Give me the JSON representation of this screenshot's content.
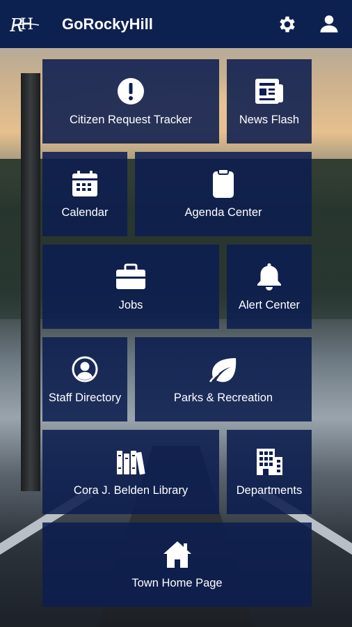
{
  "app": {
    "title": "GoRockyHill",
    "logo_text": "RH"
  },
  "tiles": [
    {
      "label": "Citizen Request Tracker",
      "icon": "exclamation-circle-icon"
    },
    {
      "label": "News Flash",
      "icon": "newspaper-icon"
    },
    {
      "label": "Calendar",
      "icon": "calendar-icon"
    },
    {
      "label": "Agenda Center",
      "icon": "clipboard-icon"
    },
    {
      "label": "Jobs",
      "icon": "briefcase-icon"
    },
    {
      "label": "Alert Center",
      "icon": "bell-icon"
    },
    {
      "label": "Staff Directory",
      "icon": "user-circle-icon"
    },
    {
      "label": "Parks & Recreation",
      "icon": "leaf-icon"
    },
    {
      "label": "Cora J. Belden Library",
      "icon": "books-icon"
    },
    {
      "label": "Departments",
      "icon": "building-icon"
    },
    {
      "label": "Town Home Page",
      "icon": "home-icon"
    }
  ],
  "colors": {
    "header": "#0d2150",
    "tile": "#0c1e50",
    "icon": "#ffffff"
  }
}
